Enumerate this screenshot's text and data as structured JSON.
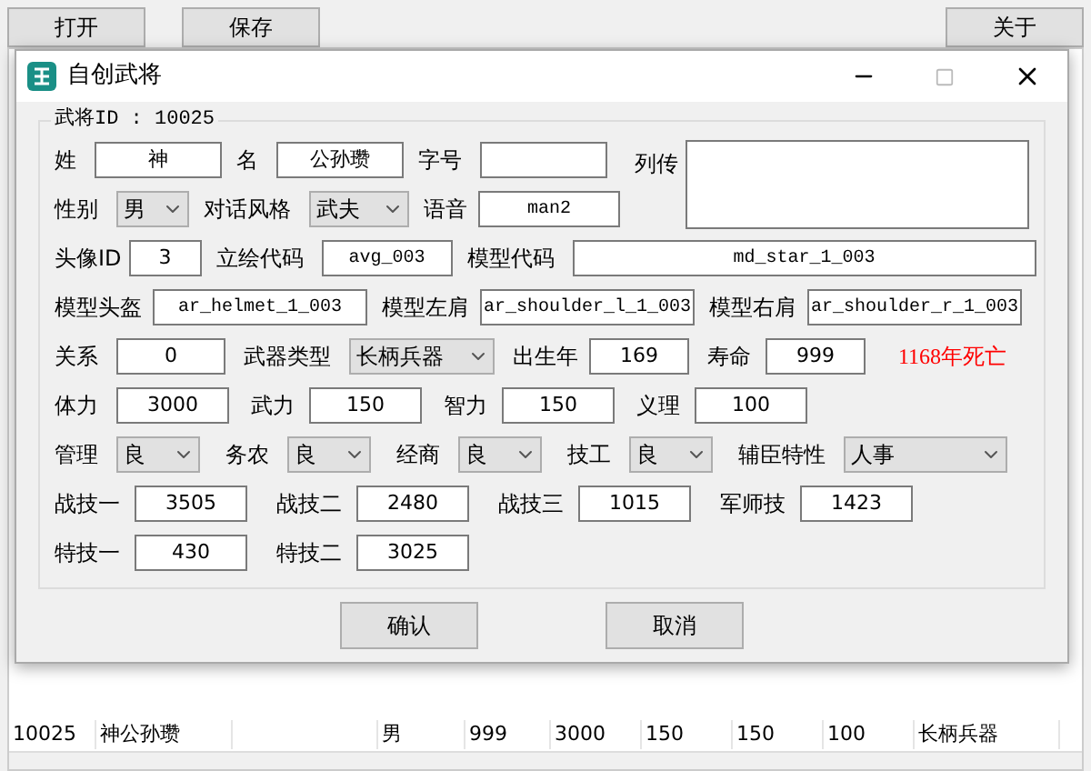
{
  "background": {
    "buttons": [
      "打开",
      "保存",
      "关于"
    ],
    "table_row": {
      "id": "10025",
      "name": "神公孙瓒",
      "gender": "男",
      "column_5": "999",
      "column_6": "3000",
      "column_7": "150",
      "column_8": "150",
      "column_9": "100",
      "column_10": "长柄兵器"
    }
  },
  "dialog": {
    "title": "自创武将",
    "group_title": "武将ID : 10025",
    "biography_label": "列传",
    "form_lines": [
      {
        "fields": [
          {
            "label": "姓",
            "kind": "text",
            "value": "神"
          },
          {
            "label": "名",
            "kind": "text",
            "value": "公孙瓒"
          },
          {
            "label": "字号",
            "kind": "text"
          }
        ]
      },
      {
        "fields": [
          {
            "label": "性别",
            "kind": "select",
            "value": "男"
          },
          {
            "label": "对话风格",
            "kind": "select",
            "value": "武夫"
          },
          {
            "label": "语音",
            "kind": "code",
            "value": "man2"
          }
        ]
      },
      {
        "fields": [
          {
            "label": "头像ID",
            "kind": "text",
            "value": "3"
          },
          {
            "label": "立绘代码",
            "kind": "code",
            "value": "avg_003"
          },
          {
            "label": "模型代码",
            "kind": "code",
            "value": "md_star_1_003"
          }
        ]
      },
      {
        "fields": [
          {
            "label": "模型头盔",
            "kind": "code",
            "value": "ar_helmet_1_003"
          },
          {
            "label": "模型左肩",
            "kind": "code",
            "value": "ar_shoulder_l_1_003"
          },
          {
            "label": "模型右肩",
            "kind": "code",
            "value": "ar_shoulder_r_1_003"
          }
        ]
      },
      {
        "fields": [
          {
            "label": "关系",
            "kind": "text",
            "value": "0"
          },
          {
            "label": "武器类型",
            "kind": "select",
            "value": "长柄兵器"
          },
          {
            "label": "出生年",
            "kind": "text",
            "value": "169"
          },
          {
            "label": "寿命",
            "kind": "text",
            "value": "999"
          },
          {
            "kind": "note",
            "value": "1168年死亡"
          }
        ]
      },
      {
        "fields": [
          {
            "label": "体力",
            "kind": "text",
            "value": "3000"
          },
          {
            "label": "武力",
            "kind": "text",
            "value": "150"
          },
          {
            "label": "智力",
            "kind": "text",
            "value": "150"
          },
          {
            "label": "义理",
            "kind": "text",
            "value": "100"
          }
        ]
      },
      {
        "fields": [
          {
            "label": "管理",
            "kind": "select",
            "value": "良"
          },
          {
            "label": "务农",
            "kind": "select",
            "value": "良"
          },
          {
            "label": "经商",
            "kind": "select",
            "value": "良"
          },
          {
            "label": "技工",
            "kind": "select",
            "value": "良"
          },
          {
            "label": "辅臣特性",
            "kind": "select",
            "value": "人事"
          }
        ]
      },
      {
        "fields": [
          {
            "label": "战技一",
            "kind": "text",
            "value": "3505"
          },
          {
            "label": "战技二",
            "kind": "text",
            "value": "2480"
          },
          {
            "label": "战技三",
            "kind": "text",
            "value": "1015"
          },
          {
            "label": "军师技",
            "kind": "text",
            "value": "1423"
          }
        ]
      },
      {
        "fields": [
          {
            "label": "特技一",
            "kind": "text",
            "value": "430"
          },
          {
            "label": "特技二",
            "kind": "text",
            "value": "3025"
          }
        ]
      }
    ],
    "buttons": [
      "确认",
      "取消"
    ]
  }
}
